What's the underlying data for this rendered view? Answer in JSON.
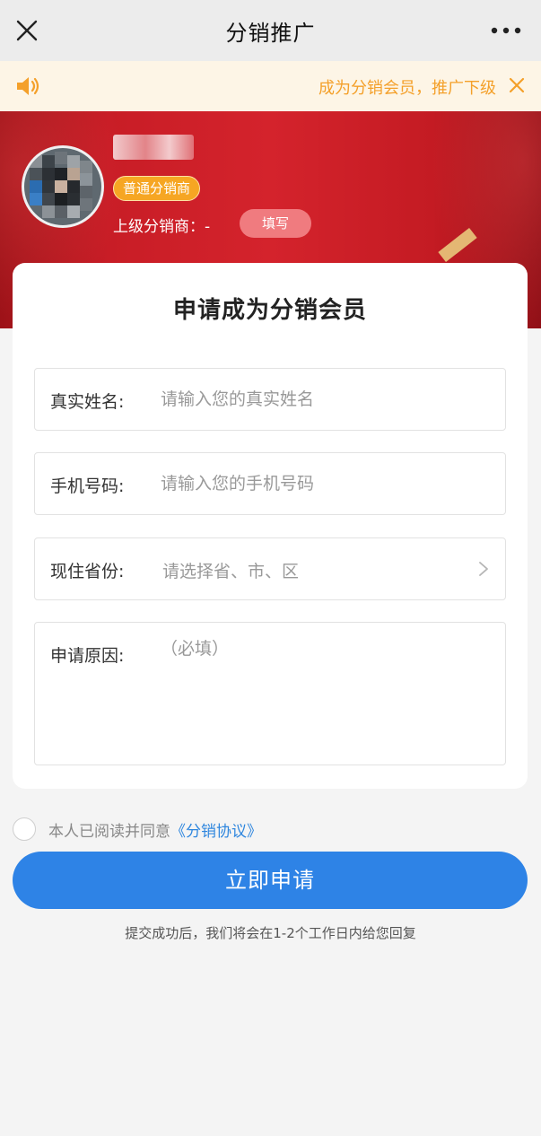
{
  "header": {
    "title": "分销推广"
  },
  "notice": {
    "text": "成为分销会员，推广下级"
  },
  "profile": {
    "level_badge": "普通分销商",
    "upline_label": "上级分销商：-",
    "fill_button": "填写"
  },
  "form": {
    "title": "申请成为分销会员",
    "fields": [
      {
        "label": "真实姓名:",
        "placeholder": "请输入您的真实姓名",
        "value": ""
      },
      {
        "label": "手机号码:",
        "placeholder": "请输入您的手机号码",
        "value": ""
      },
      {
        "label": "现住省份:",
        "placeholder": "请选择省、市、区",
        "value": ""
      },
      {
        "label": "申请原因:",
        "placeholder": "（必填）",
        "value": ""
      }
    ]
  },
  "agreement": {
    "text": "本人已阅读并同意",
    "link": "《分销协议》",
    "checked": false
  },
  "submit": {
    "label": "立即申请"
  },
  "hint": "提交成功后，我们将会在1-2个工作日内给您回复",
  "colors": {
    "primary": "#2e83e6",
    "notice": "#f4a02a",
    "banner_red": "#d4232c",
    "badge": "#f6a623"
  }
}
